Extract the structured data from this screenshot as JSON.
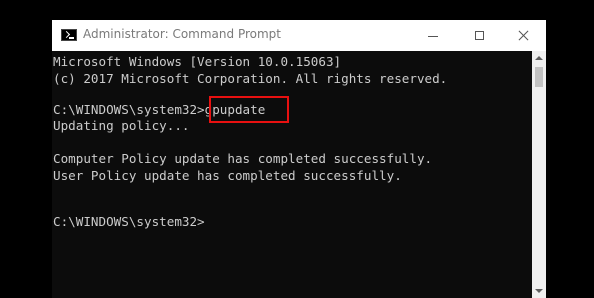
{
  "window": {
    "title": "Administrator: Command Prompt"
  },
  "console": {
    "lines": [
      "Microsoft Windows [Version 10.0.15063]",
      "(c) 2017 Microsoft Corporation. All rights reserved.",
      "",
      "C:\\WINDOWS\\system32>gpupdate",
      "Updating policy...",
      "",
      "Computer Policy update has completed successfully.",
      "User Policy update has completed successfully.",
      "",
      "",
      "C:\\WINDOWS\\system32>"
    ],
    "highlighted_command": "gpupdate"
  },
  "colors": {
    "console_background": "#0c0c0c",
    "console_text": "#cccccc",
    "highlight_border": "#e81010",
    "titlebar_background": "#ffffff"
  },
  "icons": [
    "cmd-app-icon",
    "minimize-icon",
    "maximize-icon",
    "close-icon",
    "scroll-up-arrow-icon",
    "scroll-down-arrow-icon"
  ]
}
